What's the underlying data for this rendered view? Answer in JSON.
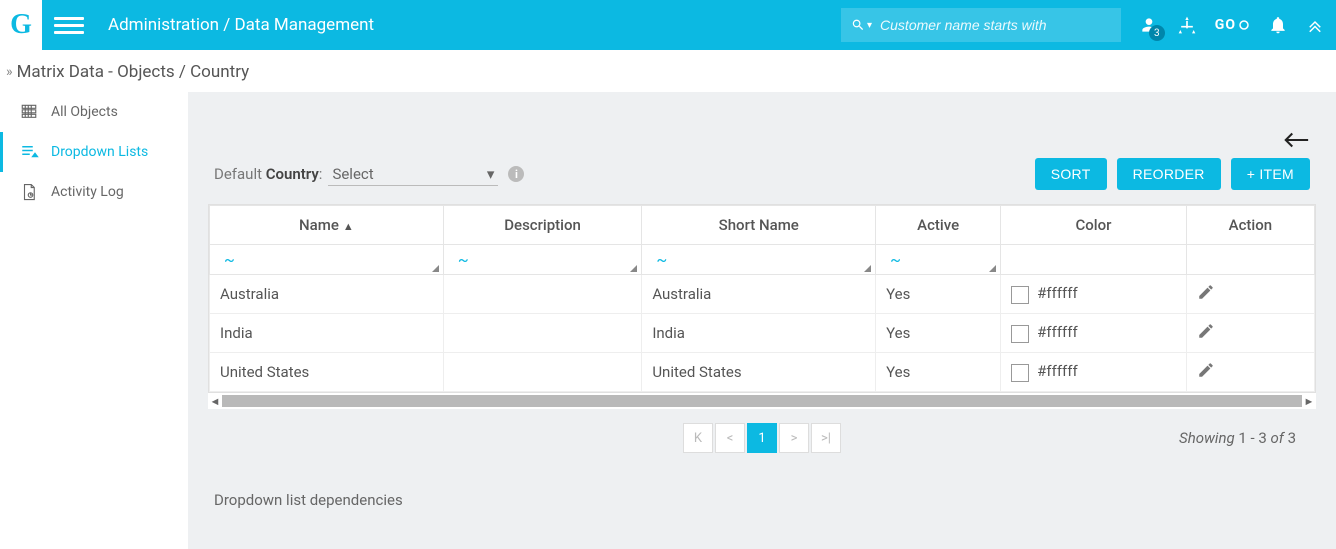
{
  "header": {
    "logo_text": "G",
    "breadcrumb": "Administration / Data Management",
    "search_placeholder": "Customer name starts with",
    "go_label": "GO",
    "notification_count": "3"
  },
  "page_title": "Matrix Data - Objects / Country",
  "sidebar": {
    "items": [
      {
        "label": "All Objects"
      },
      {
        "label": "Dropdown Lists"
      },
      {
        "label": "Activity Log"
      }
    ]
  },
  "controls": {
    "default_prefix": "Default ",
    "default_bold": "Country",
    "default_suffix": ":",
    "select_value": "Select",
    "buttons": {
      "sort": "SORT",
      "reorder": "REORDER",
      "add_item": "+ ITEM"
    }
  },
  "table": {
    "columns": {
      "name": "Name",
      "description": "Description",
      "short_name": "Short Name",
      "active": "Active",
      "color": "Color",
      "action": "Action"
    },
    "filter_glyph": "~",
    "rows": [
      {
        "name": "Australia",
        "description": "",
        "short_name": "Australia",
        "active": "Yes",
        "color": "#ffffff"
      },
      {
        "name": "India",
        "description": "",
        "short_name": "India",
        "active": "Yes",
        "color": "#ffffff"
      },
      {
        "name": "United States",
        "description": "",
        "short_name": "United States",
        "active": "Yes",
        "color": "#ffffff"
      }
    ]
  },
  "pagination": {
    "current": "1",
    "showing_prefix": "Showing ",
    "showing_range": "1 - 3",
    "showing_mid": " of ",
    "showing_total": "3"
  },
  "dependencies_label": "Dropdown list dependencies"
}
